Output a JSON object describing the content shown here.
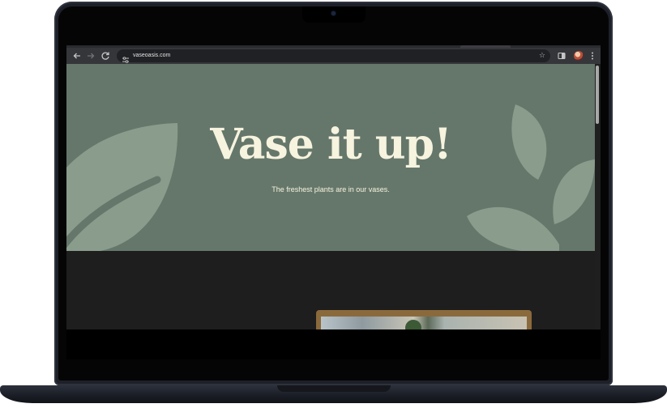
{
  "browser": {
    "url": "vaseoasis.com",
    "nav": {
      "back_icon": "arrow-left-icon",
      "forward_icon": "arrow-right-icon",
      "reload_icon": "reload-icon"
    },
    "toolbar_icons": [
      "star-icon",
      "side-panel-icon",
      "extension-icon",
      "menu-kebab-icon"
    ]
  },
  "hero": {
    "title": "Vase it up!",
    "subtitle": "The freshest plants are in our vases.",
    "background_color": "#65776a",
    "leaf_color": "#8a9c8c",
    "text_color": "#f6f3df"
  },
  "page": {
    "background_color": "#1e1e1e"
  }
}
